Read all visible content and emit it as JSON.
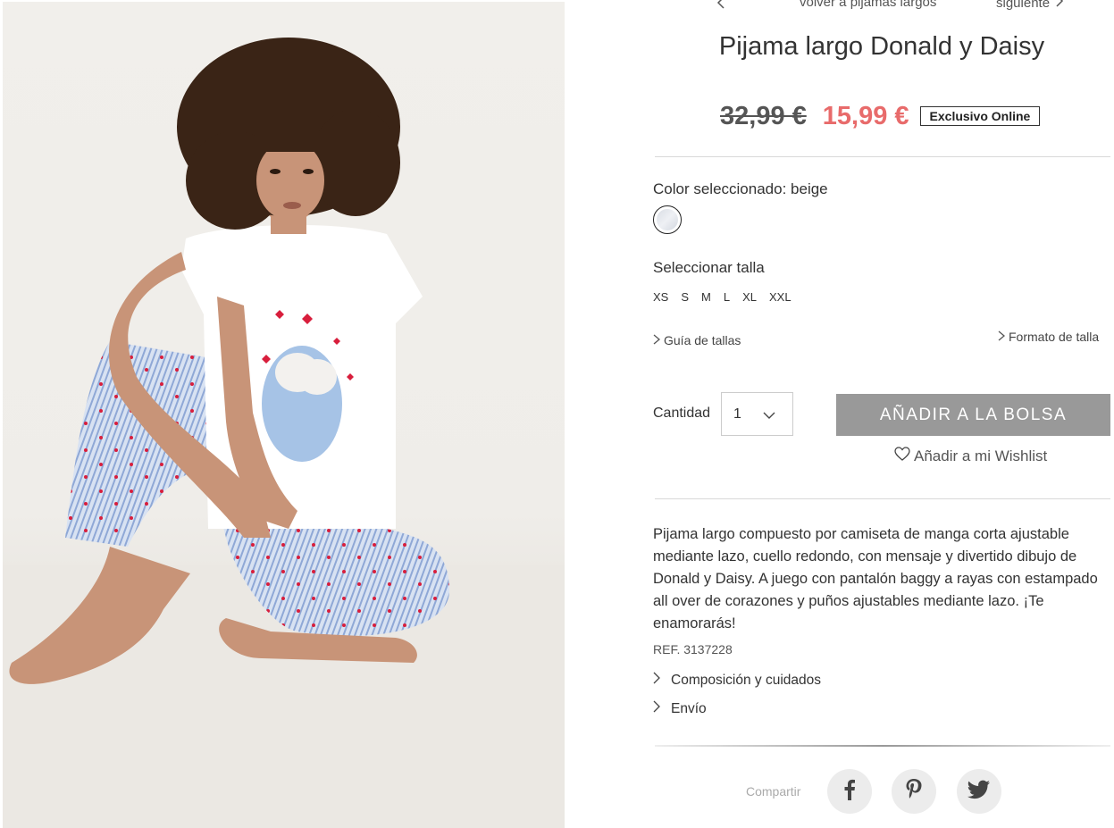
{
  "nav": {
    "prev_icon": "chevron-left-icon",
    "back_label": "volver a pijamas largos",
    "next_label": "siguiente",
    "next_icon": "chevron-right-icon"
  },
  "product": {
    "title": "Pijama largo Donald y Daisy",
    "old_price": "32,99 €",
    "new_price": "15,99 €",
    "badge": "Exclusivo Online",
    "price_color": "#e86b6b"
  },
  "color": {
    "label": "Color seleccionado: beige",
    "swatch_name": "beige"
  },
  "size": {
    "label": "Seleccionar talla",
    "options": [
      "XS",
      "S",
      "M",
      "L",
      "XL",
      "XXL"
    ],
    "guide_label": "Guía de tallas",
    "format_label": "Formato de talla"
  },
  "cart": {
    "qty_label": "Cantidad",
    "qty_value": "1",
    "add_label": "AÑADIR A LA BOLSA",
    "add_color": "#999999",
    "wishlist_label": "Añadir a mi Wishlist"
  },
  "details": {
    "description": "Pijama largo compuesto por camiseta de manga corta ajustable mediante lazo, cuello redondo, con mensaje y divertido dibujo de Donald y Daisy. A juego con pantalón baggy a rayas con estampado all over de corazones y puños ajustables mediante lazo. ¡Te enamorarás!",
    "ref": "REF. 3137228",
    "composition_label": "Composición y cuidados",
    "shipping_label": "Envío"
  },
  "share": {
    "label": "Compartir",
    "icons": [
      "facebook-icon",
      "pinterest-icon",
      "twitter-icon"
    ]
  }
}
